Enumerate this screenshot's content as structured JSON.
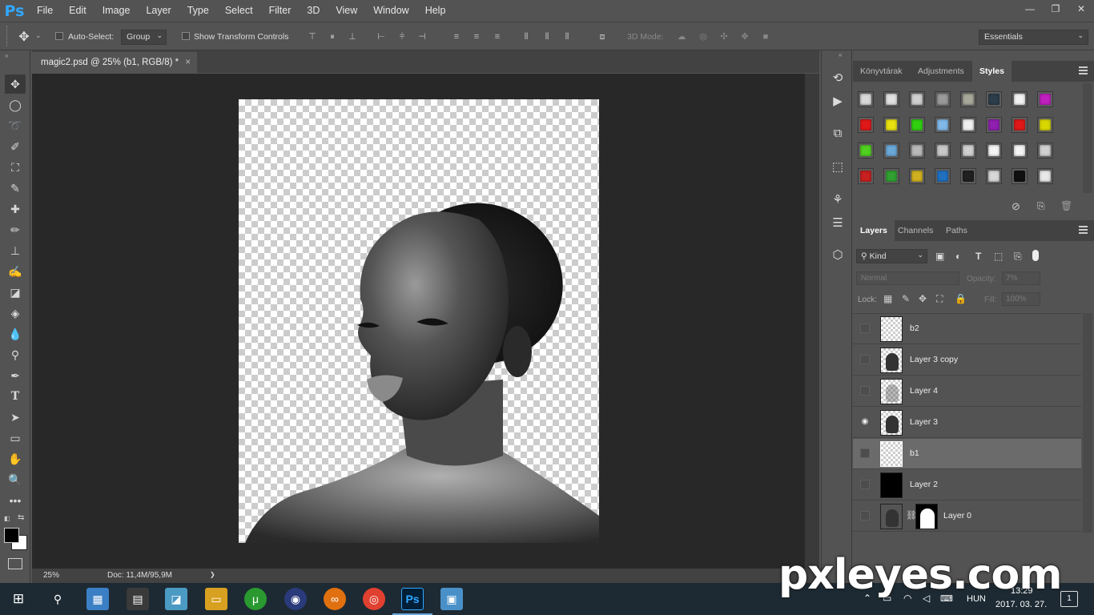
{
  "app": {
    "logo": "Ps"
  },
  "menu": [
    "File",
    "Edit",
    "Image",
    "Layer",
    "Type",
    "Select",
    "Filter",
    "3D",
    "View",
    "Window",
    "Help"
  ],
  "window_controls": {
    "minimize": "—",
    "restore": "❐",
    "close": "✕"
  },
  "options": {
    "auto_select_label": "Auto-Select:",
    "auto_select_value": "Group",
    "show_transform_label": "Show Transform Controls",
    "mode_3d_label": "3D Mode:",
    "workspace": "Essentials"
  },
  "document": {
    "tab_title": "magic2.psd @ 25% (b1, RGB/8) *",
    "close": "×",
    "zoom": "25%",
    "doc_info": "Doc: 11,4M/95,9M",
    "arrow": "❯"
  },
  "panels": {
    "top_tabs": [
      "Könyvtárak",
      "Adjustments",
      "Styles"
    ],
    "top_active": "Styles",
    "layer_tabs": [
      "Layers",
      "Channels",
      "Paths"
    ],
    "layer_active": "Layers",
    "filter_kind": "Kind",
    "blend_mode": "Normal",
    "opacity_label": "Opacity:",
    "opacity_value": "7%",
    "lock_label": "Lock:",
    "fill_label": "Fill:",
    "fill_value": "100%",
    "style_colors": [
      [
        "#d8d8d8",
        "#e0e0e0",
        "#cfcfcf",
        "#9a9a9a",
        "#a8a89a",
        "#2c3e4c",
        "#f2f2f2",
        "#c020c0"
      ],
      [
        "#e01818",
        "#e8e010",
        "#30d010",
        "#80b8e8",
        "#f0f0f0",
        "#9020b0",
        "#e01818",
        "#d8d800"
      ],
      [
        "#50d020",
        "#6aa8d8",
        "#b8b8b8",
        "#c8c8c8",
        "#d0d0d0",
        "#f4f4f4",
        "#f4f4f4",
        "#d0d0d0"
      ],
      [
        "#c82020",
        "#30a030",
        "#d0b020",
        "#2070c0",
        "#202020",
        "#d8d8d8",
        "#101010",
        "#e8e8e8"
      ]
    ],
    "layers": [
      {
        "name": "b2",
        "visible": false,
        "thumb": "transparent"
      },
      {
        "name": "Layer 3 copy",
        "visible": false,
        "thumb": "face"
      },
      {
        "name": "Layer 4",
        "visible": false,
        "thumb": "hair"
      },
      {
        "name": "Layer 3",
        "visible": true,
        "thumb": "face"
      },
      {
        "name": "b1",
        "visible": false,
        "thumb": "transparent",
        "selected": true
      },
      {
        "name": "Layer 2",
        "visible": false,
        "thumb": "black"
      },
      {
        "name": "Layer 0",
        "visible": false,
        "thumb": "photo-mask"
      }
    ]
  },
  "taskbar": {
    "language": "HUN",
    "date": "2017. 03. 27.",
    "time": "13:29",
    "notif_count": "1"
  },
  "watermark": "pxleyes.com"
}
